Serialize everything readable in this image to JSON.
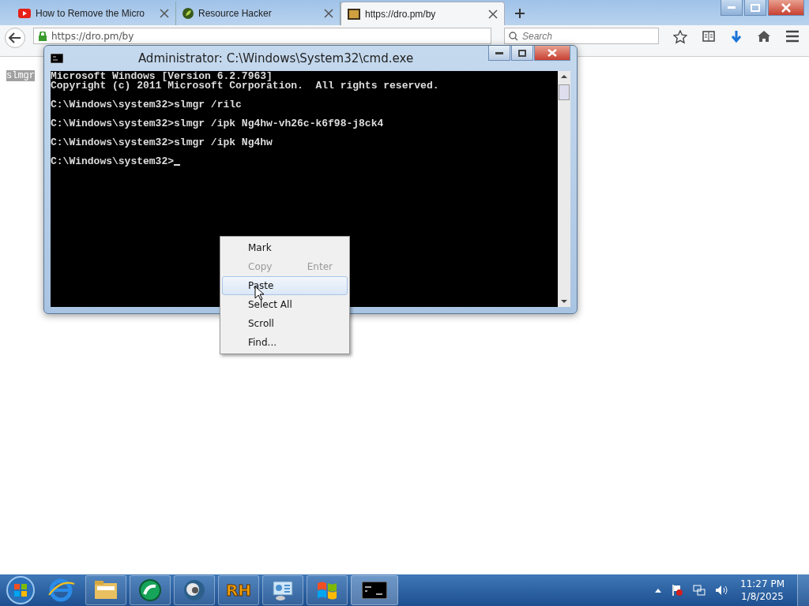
{
  "browser": {
    "tabs": [
      {
        "title": "How to Remove the Micro",
        "selected": false
      },
      {
        "title": "Resource Hacker",
        "selected": false
      },
      {
        "title": "https://dro.pm/by",
        "selected": true
      }
    ],
    "address": "https://dro.pm/by",
    "search": {
      "placeholder": "Search"
    }
  },
  "page": {
    "selected_text": "slmgr"
  },
  "console_window": {
    "title": "Administrator: C:\\Windows\\System32\\cmd.exe",
    "header": [
      "Microsoft Windows [Version 6.2.7963]",
      "Copyright (c) 2011 Microsoft Corporation.  All rights reserved."
    ],
    "commands": [
      "C:\\Windows\\system32>slmgr /rilc",
      "C:\\Windows\\system32>slmgr /ipk Ng4hw-vh26c-k6f98-j8ck4",
      "C:\\Windows\\system32>slmgr /ipk Ng4hw",
      "C:\\Windows\\system32>"
    ]
  },
  "context_menu": {
    "items": [
      {
        "label": "Mark",
        "disabled": false,
        "selected": false
      },
      {
        "label": "Copy",
        "shortcut": "Enter",
        "disabled": true,
        "selected": false
      },
      {
        "label": "Paste",
        "disabled": false,
        "selected": true
      },
      {
        "label": "Select All",
        "disabled": false,
        "selected": false
      },
      {
        "label": "Scroll",
        "disabled": false,
        "selected": false
      },
      {
        "label": "Find...",
        "disabled": false,
        "selected": false
      }
    ]
  },
  "taskbar": {
    "rh_label": "RH",
    "time": "11:27 PM",
    "date": "1/8/2025"
  }
}
